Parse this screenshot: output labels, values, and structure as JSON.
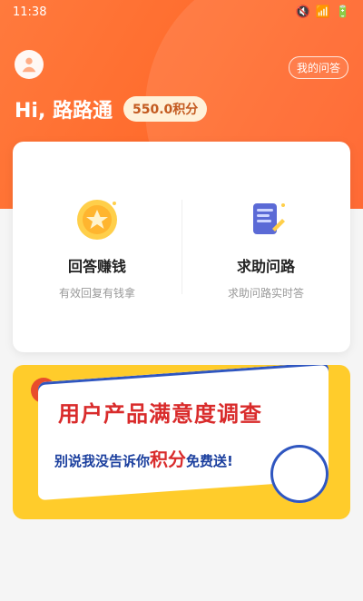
{
  "status": {
    "time": "11:38"
  },
  "header": {
    "my_qa": "我的问答",
    "greeting": "Hi, 路路通",
    "points": "550.0积分"
  },
  "card": {
    "left": {
      "title": "回答赚钱",
      "subtitle": "有效回复有钱拿"
    },
    "right": {
      "title": "求助问路",
      "subtitle": "求助问路实时答"
    }
  },
  "banner": {
    "title": "用户产品满意度调查",
    "sub_prefix": "别说我没告诉你",
    "sub_points": "积分",
    "sub_suffix": "免费送!"
  },
  "colors": {
    "orange": "#ff6a2b",
    "yellow": "#ffcc2b",
    "red": "#d92b2b",
    "blue": "#2f56c0"
  }
}
